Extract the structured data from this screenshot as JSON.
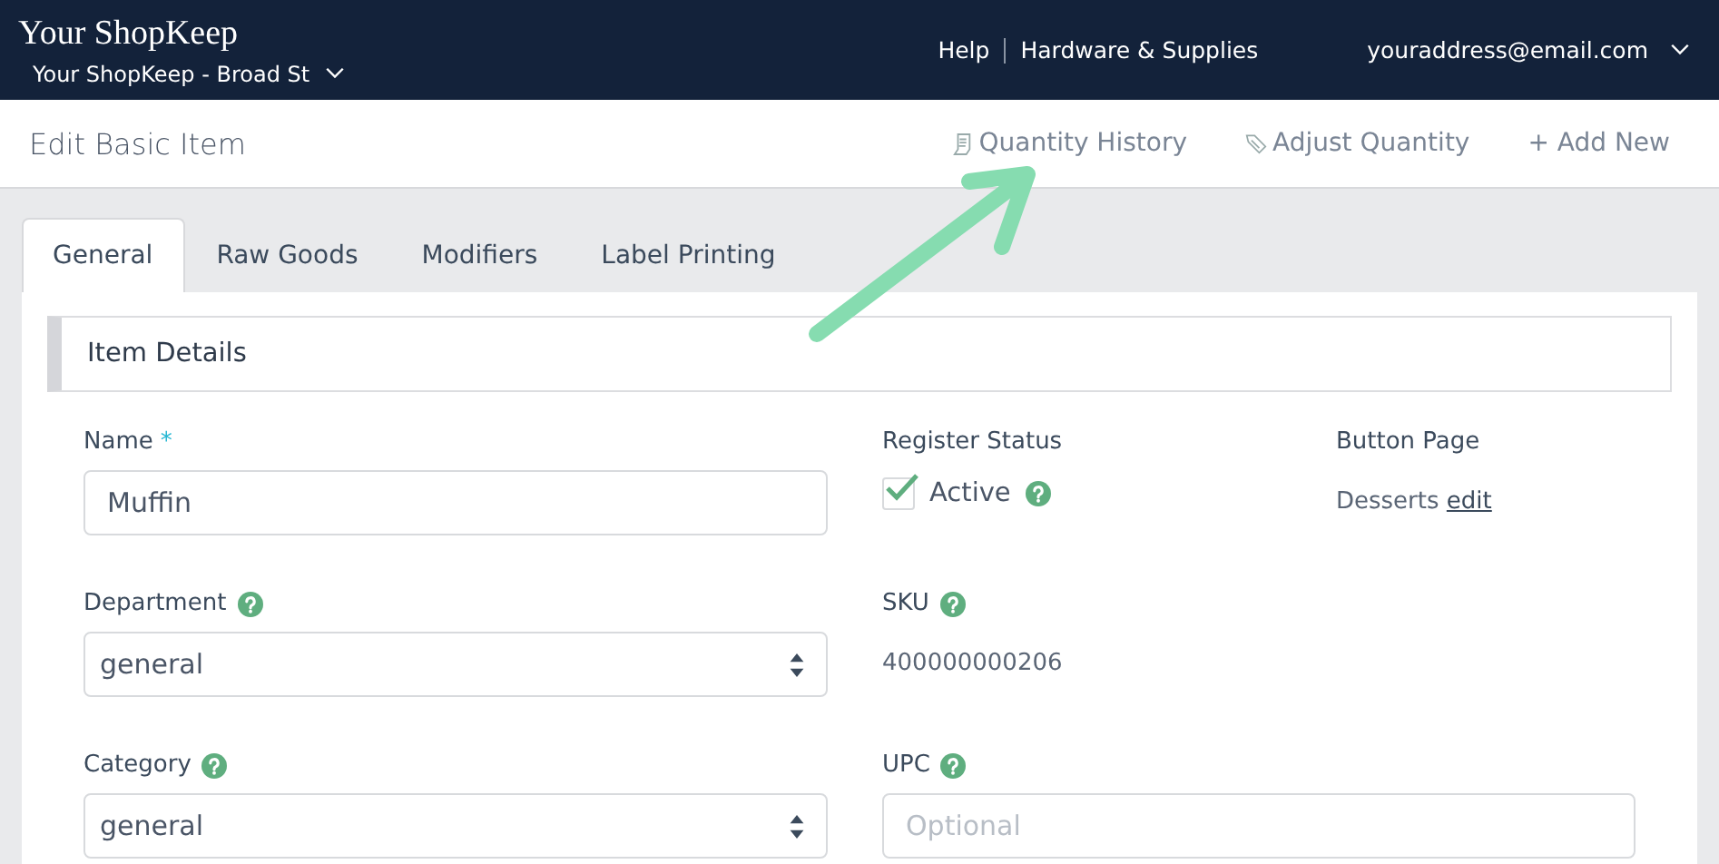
{
  "header": {
    "brand": "Your ShopKeep",
    "store": "Your ShopKeep - Broad St",
    "links": [
      "Help",
      "Hardware & Supplies"
    ],
    "account": "youraddress@email.com"
  },
  "page": {
    "title": "Edit Basic Item",
    "actions": [
      {
        "kind": "history",
        "label": "Quantity History"
      },
      {
        "kind": "adjust",
        "label": "Adjust Quantity"
      },
      {
        "kind": "add",
        "label": "+ Add New"
      }
    ]
  },
  "tabs": [
    {
      "label": "General",
      "selected": true
    },
    {
      "label": "Raw Goods",
      "selected": false
    },
    {
      "label": "Modifiers",
      "selected": false
    },
    {
      "label": "Label Printing",
      "selected": false
    }
  ],
  "section": {
    "title": "Item Details"
  },
  "name": {
    "label": "Name",
    "required_mark": "*",
    "value": "Muffin"
  },
  "register_status": {
    "label": "Register Status",
    "option": "Active",
    "checked": true
  },
  "button_page": {
    "label": "Button Page",
    "value": "Desserts",
    "link": "edit"
  },
  "department": {
    "label": "Department",
    "value": "general"
  },
  "sku": {
    "label": "SKU",
    "value": "400000000206"
  },
  "category": {
    "label": "Category",
    "value": "general"
  },
  "upc": {
    "label": "UPC",
    "placeholder": "Optional"
  }
}
